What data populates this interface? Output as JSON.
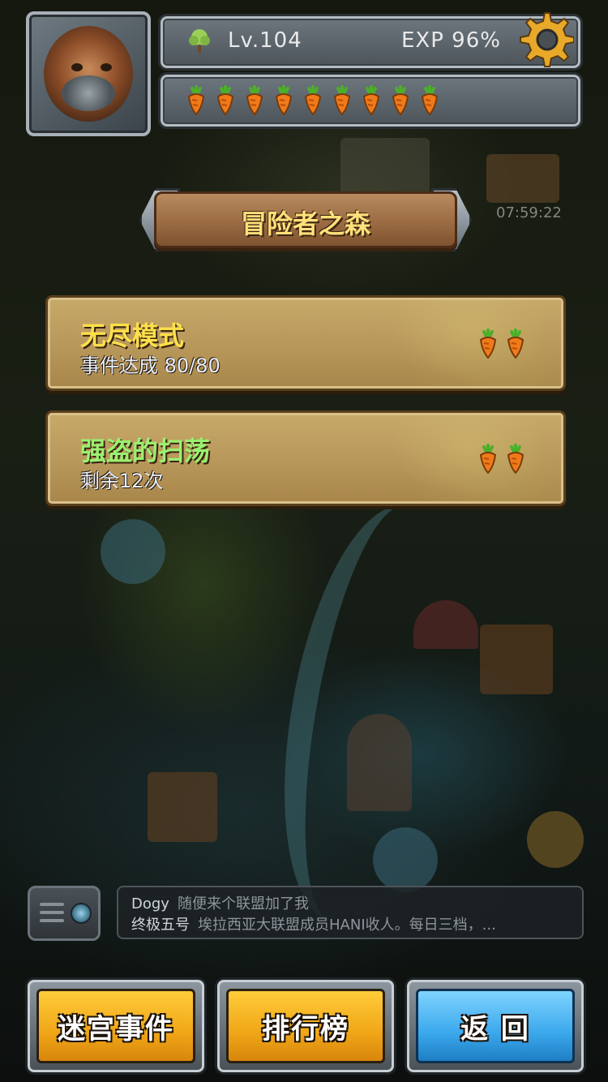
{
  "header": {
    "level_label": "Lv.104",
    "exp_label": "EXP 96%",
    "stamina_count": 9
  },
  "map": {
    "timer": "07:59:22"
  },
  "stage": {
    "title": "冒险者之森"
  },
  "modes": [
    {
      "title": "无尽模式",
      "subtitle": "事件达成  80/80",
      "cost_carrots": 2
    },
    {
      "title": "强盗的扫荡",
      "subtitle": "剩余12次",
      "cost_carrots": 2
    }
  ],
  "chat": {
    "lines": [
      {
        "name": "Dogy",
        "message": "随便来个联盟加了我"
      },
      {
        "name": "终极五号",
        "message": "埃拉西亚大联盟成员HANI收人。每日三档，..."
      }
    ]
  },
  "buttons": {
    "maze_event": "迷宫事件",
    "leaderboard": "排行榜",
    "back": "返 回"
  },
  "colors": {
    "accent_orange": "#f0a617",
    "accent_blue": "#3ba8ec",
    "title_yellow": "#ffe04a",
    "title_green": "#9af070"
  }
}
